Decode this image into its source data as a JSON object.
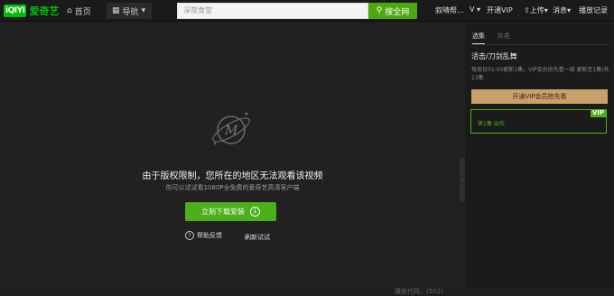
{
  "header": {
    "logo_mark": "iQIYI",
    "logo_text": "爱奇艺",
    "home_label": "首页",
    "guide_label": "导航",
    "search_placeholder": "深夜食堂",
    "search_button": "搜全网",
    "user_name": "叙晴帮...",
    "vip_open": "开通VIP",
    "upload": "上传",
    "messages": "消息",
    "history": "播放记录"
  },
  "player": {
    "message_main": "由于版权限制，您所在的地区无法观看该视频",
    "message_sub": "你可以试试看1080P全免费的爱奇艺高清客户端",
    "download_button": "立刻下载安装",
    "feedback": "帮助反馈",
    "refresh": "刷新试试",
    "error_code": "播放代码：(502)"
  },
  "sidebar": {
    "tab_episodes": "选集",
    "tab_trailer": "片花",
    "show_title": "活击/刀剑乱舞",
    "update_info": "每周日01:00更新1集，VIP会员抢先看一周 更新至1集/共13集",
    "vip_button": "开通VIP会员抢先看",
    "vip_tag": "VIP",
    "episode_label": "第1集  出阵"
  },
  "colors": {
    "accent_green": "#4caf1b",
    "vip_gold": "#c8a06a"
  }
}
